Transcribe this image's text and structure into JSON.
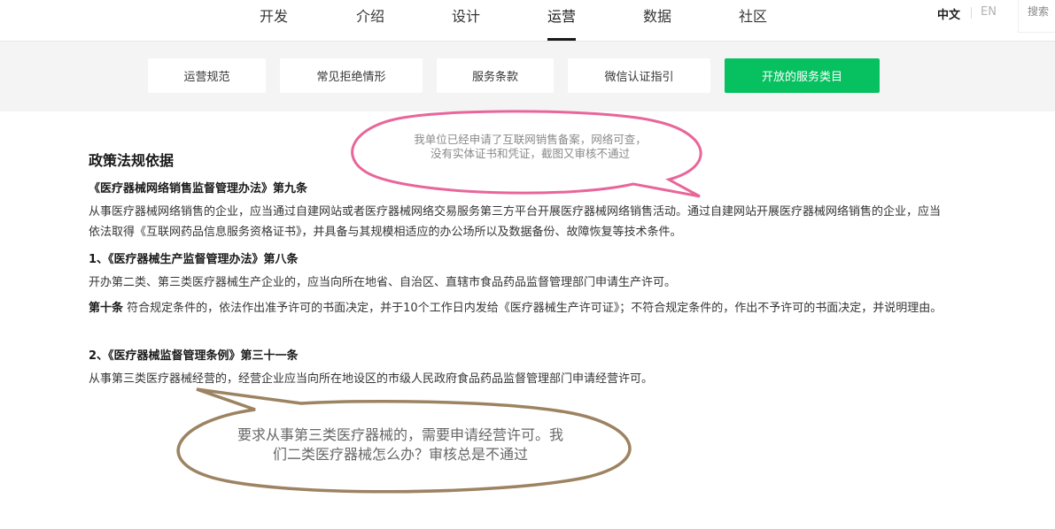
{
  "nav": {
    "items": [
      "开发",
      "介绍",
      "设计",
      "运营",
      "数据",
      "社区"
    ],
    "active": "运营",
    "lang_zh": "中文",
    "lang_en": "EN",
    "search_placeholder": "搜索"
  },
  "subtabs": {
    "items": [
      "运营规范",
      "常见拒绝情形",
      "服务条款",
      "微信认证指引",
      "开放的服务类目"
    ],
    "active": "开放的服务类目",
    "active_color": "#07c160"
  },
  "content": {
    "title": "政策法规依据",
    "law1_heading": "《医疗器械网络销售监督管理办法》第九条",
    "law1_text": "从事医疗器械网络销售的企业，应当通过自建网站或者医疗器械网络交易服务第三方平台开展医疗器械网络销售活动。通过自建网站开展医疗器械网络销售的企业，应当依法取得《互联网药品信息服务资格证书》，并具备与其规模相适应的办公场所以及数据备份、故障恢复等技术条件。",
    "law2_heading": "1、《医疗器械生产监督管理办法》第八条",
    "law2_text": "开办第二类、第三类医疗器械生产企业的，应当向所在地省、自治区、直辖市食品药品监督管理部门申请生产许可。",
    "law2_art10_label": "第十条",
    "law2_art10_text": "符合规定条件的，依法作出准予许可的书面决定，并于10个工作日内发给《医疗器械生产许可证》；不符合规定条件的，作出不予许可的书面决定，并说明理由。",
    "law3_heading": "2、《医疗器械监督管理条例》第三十一条",
    "law3_text": "从事第三类医疗器械经营的，经营企业应当向所在地设区的市级人民政府食品药品监督管理部门申请经营许可。"
  },
  "annotations": {
    "bubble1": {
      "text": "我单位已经申请了互联网销售备案，网络可查，没有实体证书和凭证，截图又审核不通过",
      "border_color": "#e8669a"
    },
    "bubble2": {
      "text": "要求从事第三类医疗器械的，需要申请经营许可。我们二类医疗器械怎么办？审核总是不通过",
      "border_color": "#9c8361"
    }
  }
}
